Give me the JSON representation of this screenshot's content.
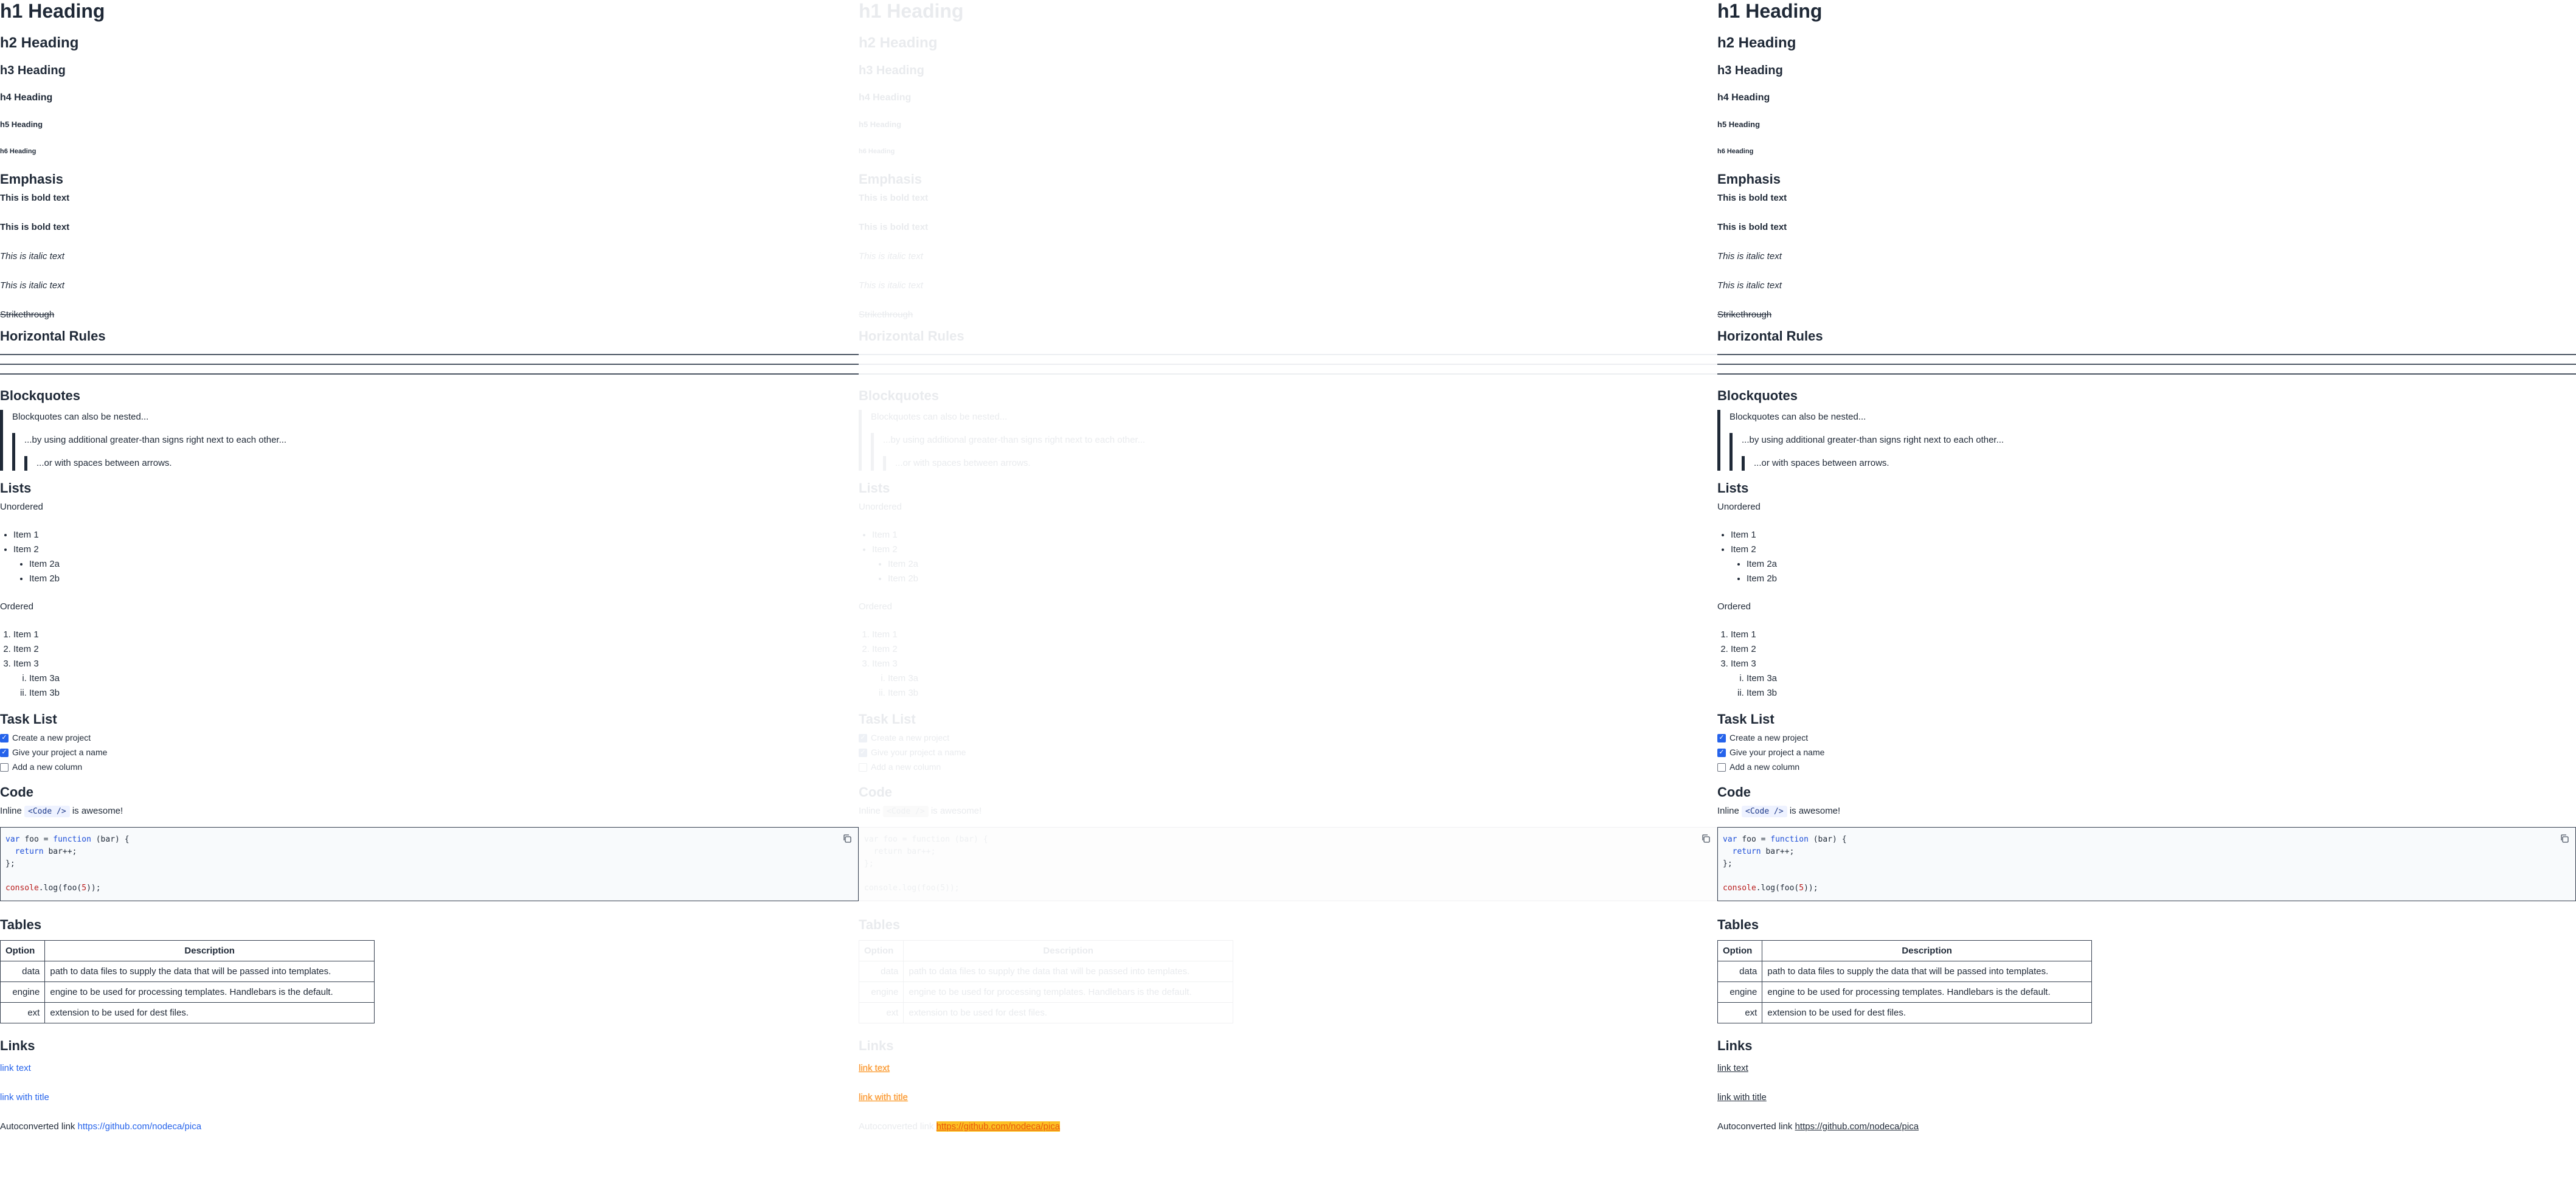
{
  "headings": {
    "h1": "h1 Heading",
    "h2": "h2 Heading",
    "h3": "h3 Heading",
    "h4": "h4 Heading",
    "h5": "h5 Heading",
    "h6": "h6 Heading"
  },
  "emphasis": {
    "title": "Emphasis",
    "bold1": "This is bold text",
    "bold2": "This is bold text",
    "italic1": "This is italic text",
    "italic2": "This is italic text",
    "strike": "Strikethrough"
  },
  "rules": {
    "title": "Horizontal Rules"
  },
  "blockquotes": {
    "title": "Blockquotes",
    "level1": "Blockquotes can also be nested...",
    "level2": "...by using additional greater-than signs right next to each other...",
    "level3": "...or with spaces between arrows."
  },
  "lists": {
    "title": "Lists",
    "unordered_label": "Unordered",
    "unordered": [
      "Item 1",
      "Item 2"
    ],
    "unordered_nested": [
      "Item 2a",
      "Item 2b"
    ],
    "ordered_label": "Ordered",
    "ordered": [
      "Item 1",
      "Item 2",
      "Item 3"
    ],
    "ordered_nested": [
      "Item 3a",
      "Item 3b"
    ]
  },
  "tasks": {
    "title": "Task List",
    "items": [
      {
        "label": "Create a new project",
        "checked": true
      },
      {
        "label": "Give your project a name",
        "checked": true
      },
      {
        "label": "Add a new column",
        "checked": false
      }
    ]
  },
  "code": {
    "title": "Code",
    "inline_prefix": "Inline",
    "inline_code": "<Code />",
    "inline_suffix": "is awesome!",
    "block_line1_kw": "var",
    "block_line1_a": "foo = ",
    "block_line1_kw2": "function",
    "block_line1_b": " (bar) {",
    "block_line2_kw": "return",
    "block_line2_b": " bar++;",
    "block_line3": "};",
    "block_line5_fn": "console",
    "block_line5_a": ".log(foo(",
    "block_line5_num": "5",
    "block_line5_b": "));",
    "copy_icon": "copy-icon"
  },
  "tables": {
    "title": "Tables",
    "headers": [
      "Option",
      "Description"
    ],
    "rows": [
      [
        "data",
        "path to data files to supply the data that will be passed into templates."
      ],
      [
        "engine",
        "engine to be used for processing templates. Handlebars is the default."
      ],
      [
        "ext",
        "extension to be used for dest files."
      ]
    ]
  },
  "links": {
    "title": "Links",
    "link1": "link text",
    "link2": "link with title",
    "auto_prefix": "Autoconverted link",
    "auto_url": "https://github.com/nodeca/pica"
  },
  "colors": {
    "text": "#1f2937",
    "link": "#2563eb",
    "checkbox": "#2563eb",
    "faded_text": "#e9ebee",
    "link_highlight": "#f59e0b"
  }
}
